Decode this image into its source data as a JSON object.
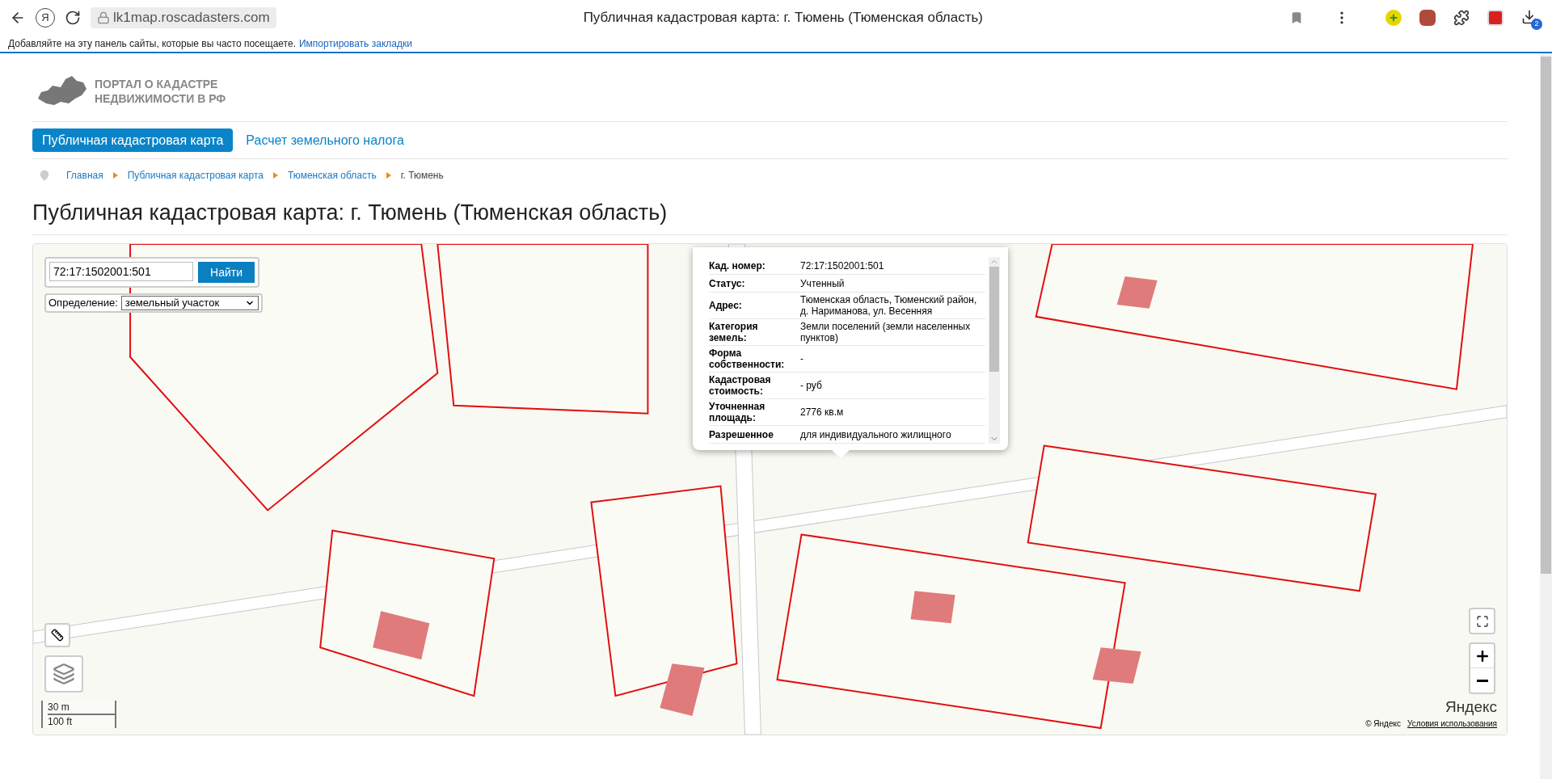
{
  "browser": {
    "home_glyph": "Я",
    "url": "lk1map.roscadasters.com",
    "tab_title": "Публичная кадастровая карта: г. Тюмень (Тюменская область)",
    "bookmarks_hint": "Добавляйте на эту панель сайты, которые вы часто посещаете.",
    "bookmarks_link": "Импортировать закладки",
    "downloads_badge": "2"
  },
  "site": {
    "logo_lines": [
      "ПОРТАЛ О КАДАСТРЕ",
      "НЕДВИЖИМОСТИ В РФ"
    ]
  },
  "nav": [
    {
      "label": "Публичная кадастровая карта",
      "selected": true
    },
    {
      "label": "Расчет земельного налога",
      "selected": false
    }
  ],
  "breadcrumbs": [
    {
      "label": "Главная",
      "link": true
    },
    {
      "label": "Публичная кадастровая карта",
      "link": true
    },
    {
      "label": "Тюменская область",
      "link": true
    },
    {
      "label": "г. Тюмень",
      "link": false
    }
  ],
  "title": "Публичная кадастровая карта: г. Тюмень (Тюменская область)",
  "map": {
    "search": {
      "value": "72:17:1502001:501",
      "button": "Найти"
    },
    "mode": {
      "label": "Определение:",
      "value": "земельный участок"
    },
    "popup": {
      "rows": [
        {
          "label": "Кад. номер:",
          "value": "72:17:1502001:501"
        },
        {
          "label": "Статус:",
          "value": "Учтенный"
        },
        {
          "label": "Адрес:",
          "value": "Тюменская область, Тюменский район, д. Нариманова, ул. Весенняя"
        },
        {
          "label": "Категория земель:",
          "value": "Земли поселений (земли населенных пунктов)"
        },
        {
          "label": "Форма собственности:",
          "value": "-"
        },
        {
          "label": "Кадастровая стоимость:",
          "value": "- руб"
        },
        {
          "label": "Уточненная площадь:",
          "value": "2776 кв.м"
        },
        {
          "label": "Разрешенное",
          "value": "для индивидуального жилищного"
        }
      ]
    },
    "scale": [
      "30 m",
      "100 ft"
    ],
    "attribution": {
      "logo": "Яндекс",
      "copyright": "© Яндекс",
      "terms": "Условия использования"
    }
  }
}
